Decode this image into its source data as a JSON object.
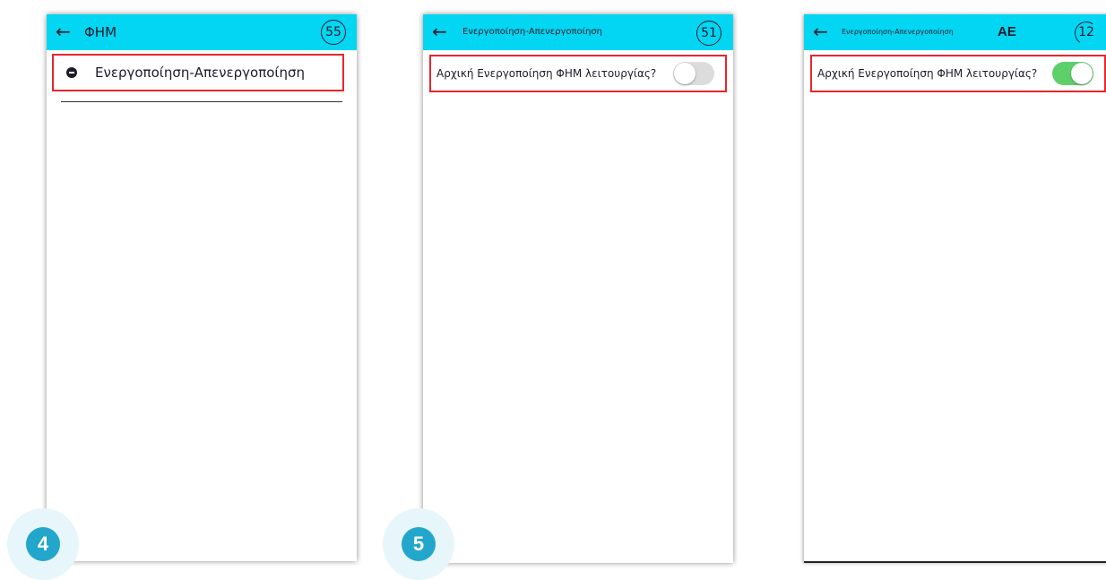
{
  "screens": [
    {
      "title": "ΦΗΜ",
      "counter": "55",
      "menu_item": "Ενεργοποίηση-Απενεργοποίηση"
    },
    {
      "title": "Ενεργοποίηση-Απενεργοποίηση",
      "counter": "51",
      "toggle_label": "Αρχική Ενεργοποίηση ΦΗΜ λειτουργίας?",
      "toggle_on": false
    },
    {
      "title": "Ενεργοποίηση-Απενεργοποίηση",
      "title_badge": "AE",
      "counter": "12",
      "toggle_label": "Αρχική Ενεργοποίηση ΦΗΜ λειτουργίας?",
      "toggle_on": true
    }
  ],
  "steps": [
    "4",
    "5"
  ],
  "colors": {
    "appbar": "#03d6f3",
    "highlight": "#e8262e",
    "toggle_on": "#5dd06a",
    "toggle_off": "#dcdcdc",
    "step_badge": "#23a6cc"
  },
  "icons": {
    "back": "←"
  }
}
